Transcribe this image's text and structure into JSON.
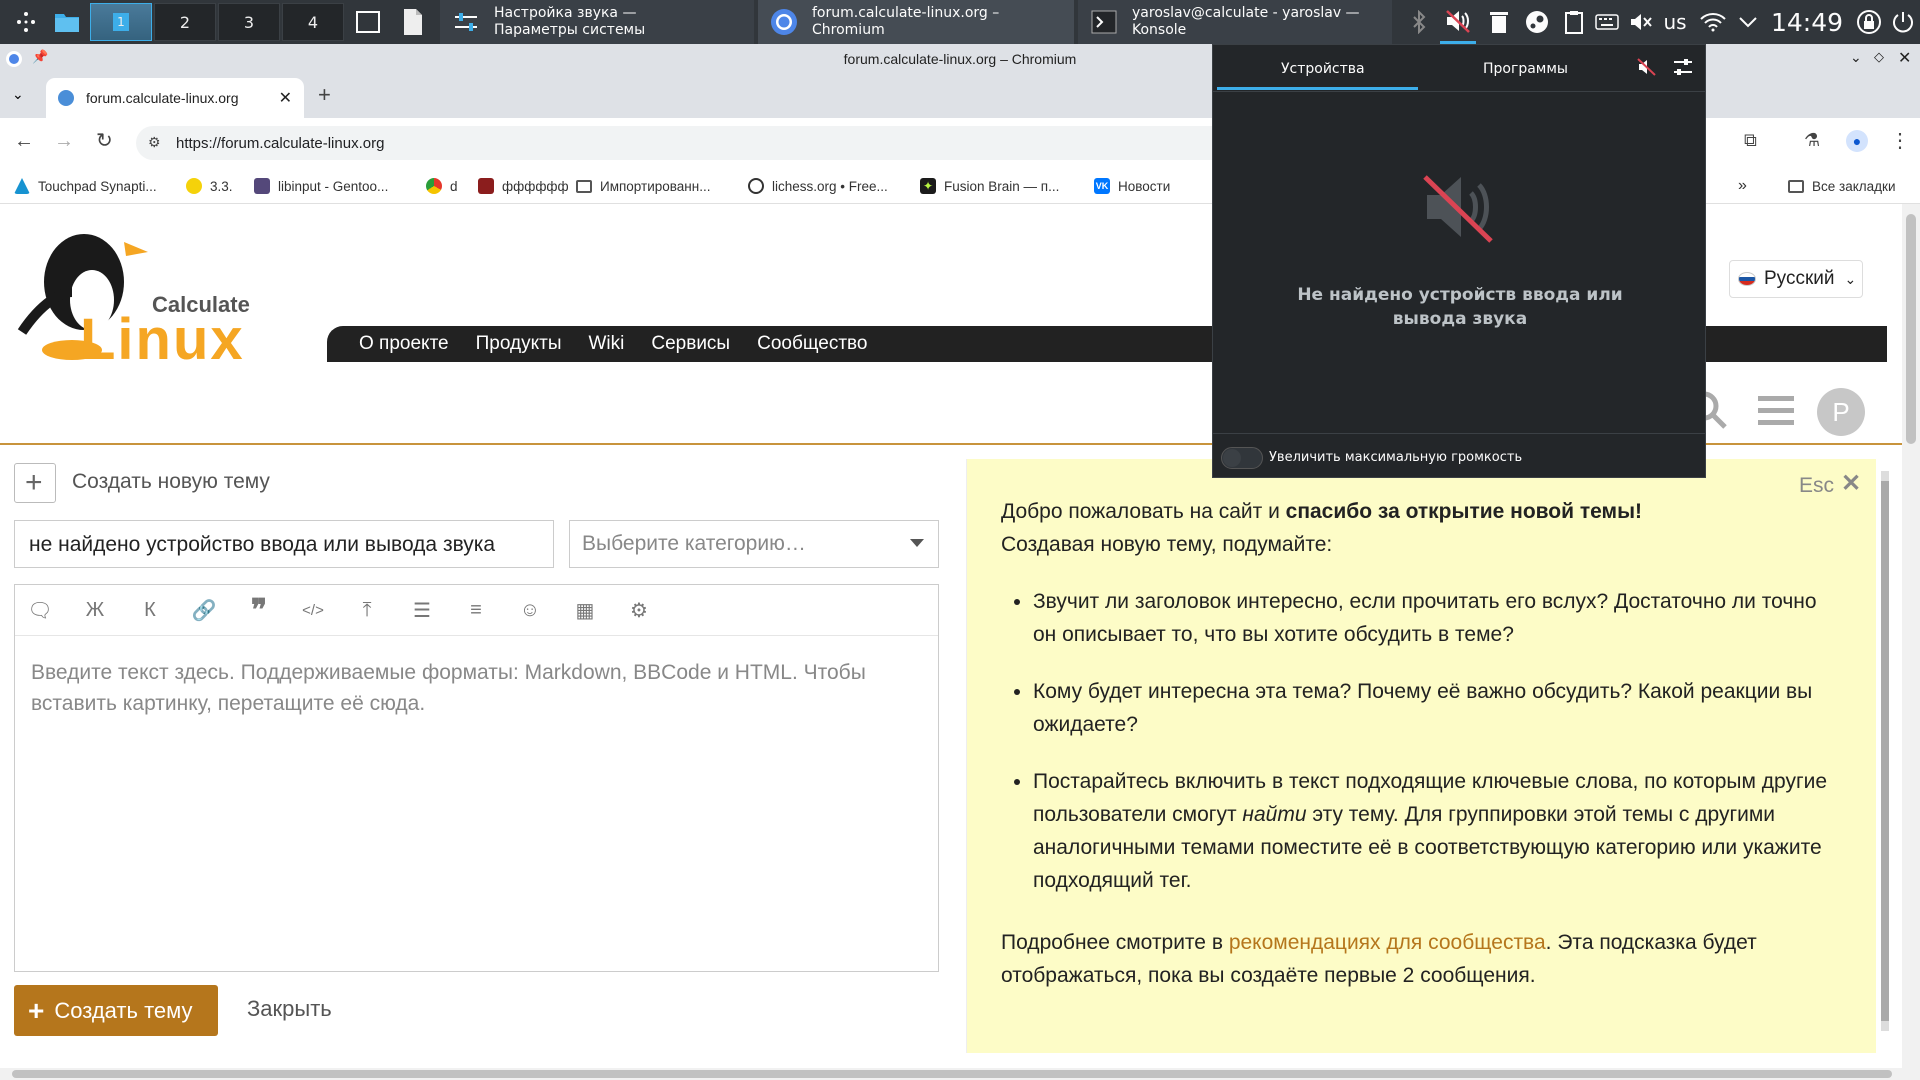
{
  "taskbar": {
    "pagers": [
      "1",
      "2",
      "3",
      "4"
    ],
    "tasks": [
      {
        "label": "Настройка звука — Параметры системы",
        "icon": "sliders-icon"
      },
      {
        "label": "forum.calculate-linux.org – Chromium",
        "icon": "chromium-icon"
      },
      {
        "label": "yaroslav@calculate - yaroslav — Konsole",
        "icon": "terminal-icon"
      }
    ],
    "keyboard_layout": "us",
    "clock": "14:49"
  },
  "browser": {
    "window_title": "forum.calculate-linux.org – Chromium",
    "tab_title": "forum.calculate-linux.org",
    "url": "https://forum.calculate-linux.org",
    "bookmarks": [
      {
        "label": "Touchpad Synapti...",
        "icon": "arch-icon",
        "color": "#1793d1"
      },
      {
        "label": "3.3.",
        "icon": "sun-icon",
        "color": "#f5d20a"
      },
      {
        "label": "libinput - Gentoo...",
        "icon": "gentoo-icon",
        "color": "#54487a"
      },
      {
        "label": "d",
        "icon": "circle-icon",
        "color": "#e5372b"
      },
      {
        "label": "фффффф",
        "icon": "fire-icon",
        "color": "#8b1d1d"
      },
      {
        "label": "Импортированн...",
        "icon": "folder-icon",
        "color": "#555555"
      },
      {
        "label": "lichess.org • Free...",
        "icon": "knight-icon",
        "color": "#333333"
      },
      {
        "label": "Fusion Brain — п...",
        "icon": "star-icon",
        "color": "#1b1b1b"
      },
      {
        "label": "Новости",
        "icon": "vk-icon",
        "color": "#0077ff"
      }
    ],
    "all_bookmarks": "Все закладки"
  },
  "site": {
    "logo_top": "Calculate",
    "logo_bottom": "Linux",
    "language": "Русский",
    "avatar_letter": "P",
    "nav": [
      "О проекте",
      "Продукты",
      "Wiki",
      "Сервисы",
      "Сообщество"
    ]
  },
  "composer": {
    "create_topic_label": "Создать новую тему",
    "title_value": "не найдено устройство ввода или вывода звука",
    "category_placeholder": "Выберите категорию…",
    "editor_placeholder": "Введите текст здесь. Поддерживаемые форматы: Markdown, BBCode и HTML. Чтобы вставить картинку, перетащите её сюда.",
    "toolbar": {
      "bold": "Ж",
      "italic": "К"
    },
    "submit_label": "Создать тему",
    "close_label": "Закрыть"
  },
  "tip": {
    "esc_label": "Esc",
    "intro_plain": "Добро пожаловать на сайт и ",
    "intro_bold": "спасибо за открытие новой темы!",
    "intro_line2": "Создавая новую тему, подумайте:",
    "bullet1": "Звучит ли заголовок интересно, если прочитать его вслух? Достаточно ли точно он описывает то, что вы хотите обсудить в теме?",
    "bullet2": "Кому будет интересна эта тема? Почему её важно обсудить? Какой реакции вы ожидаете?",
    "bullet3_a": "Постарайтесь включить в текст подходящие ключевые слова, по которым другие пользователи смогут ",
    "bullet3_em": "найти",
    "bullet3_b": " эту тему. Для группировки этой темы с другими аналогичными темами поместите её в соответствующую категорию или укажите подходящий тег.",
    "footer_a": "Подробнее смотрите в ",
    "footer_link": "рекомендациях для сообщества",
    "footer_b": ". Эта подсказка будет отображаться, пока вы создаёте первые 2 сообщения."
  },
  "audio_popup": {
    "tab_devices": "Устройства",
    "tab_apps": "Программы",
    "message": "Не найдено устройств ввода или вывода звука",
    "toggle_label": "Увеличить максимальную громкость",
    "toggle_on": false
  },
  "colors": {
    "accent": "#3daee9",
    "brand": "#b5761c",
    "link": "#b5761c",
    "tip_bg": "#fdfcc7"
  }
}
